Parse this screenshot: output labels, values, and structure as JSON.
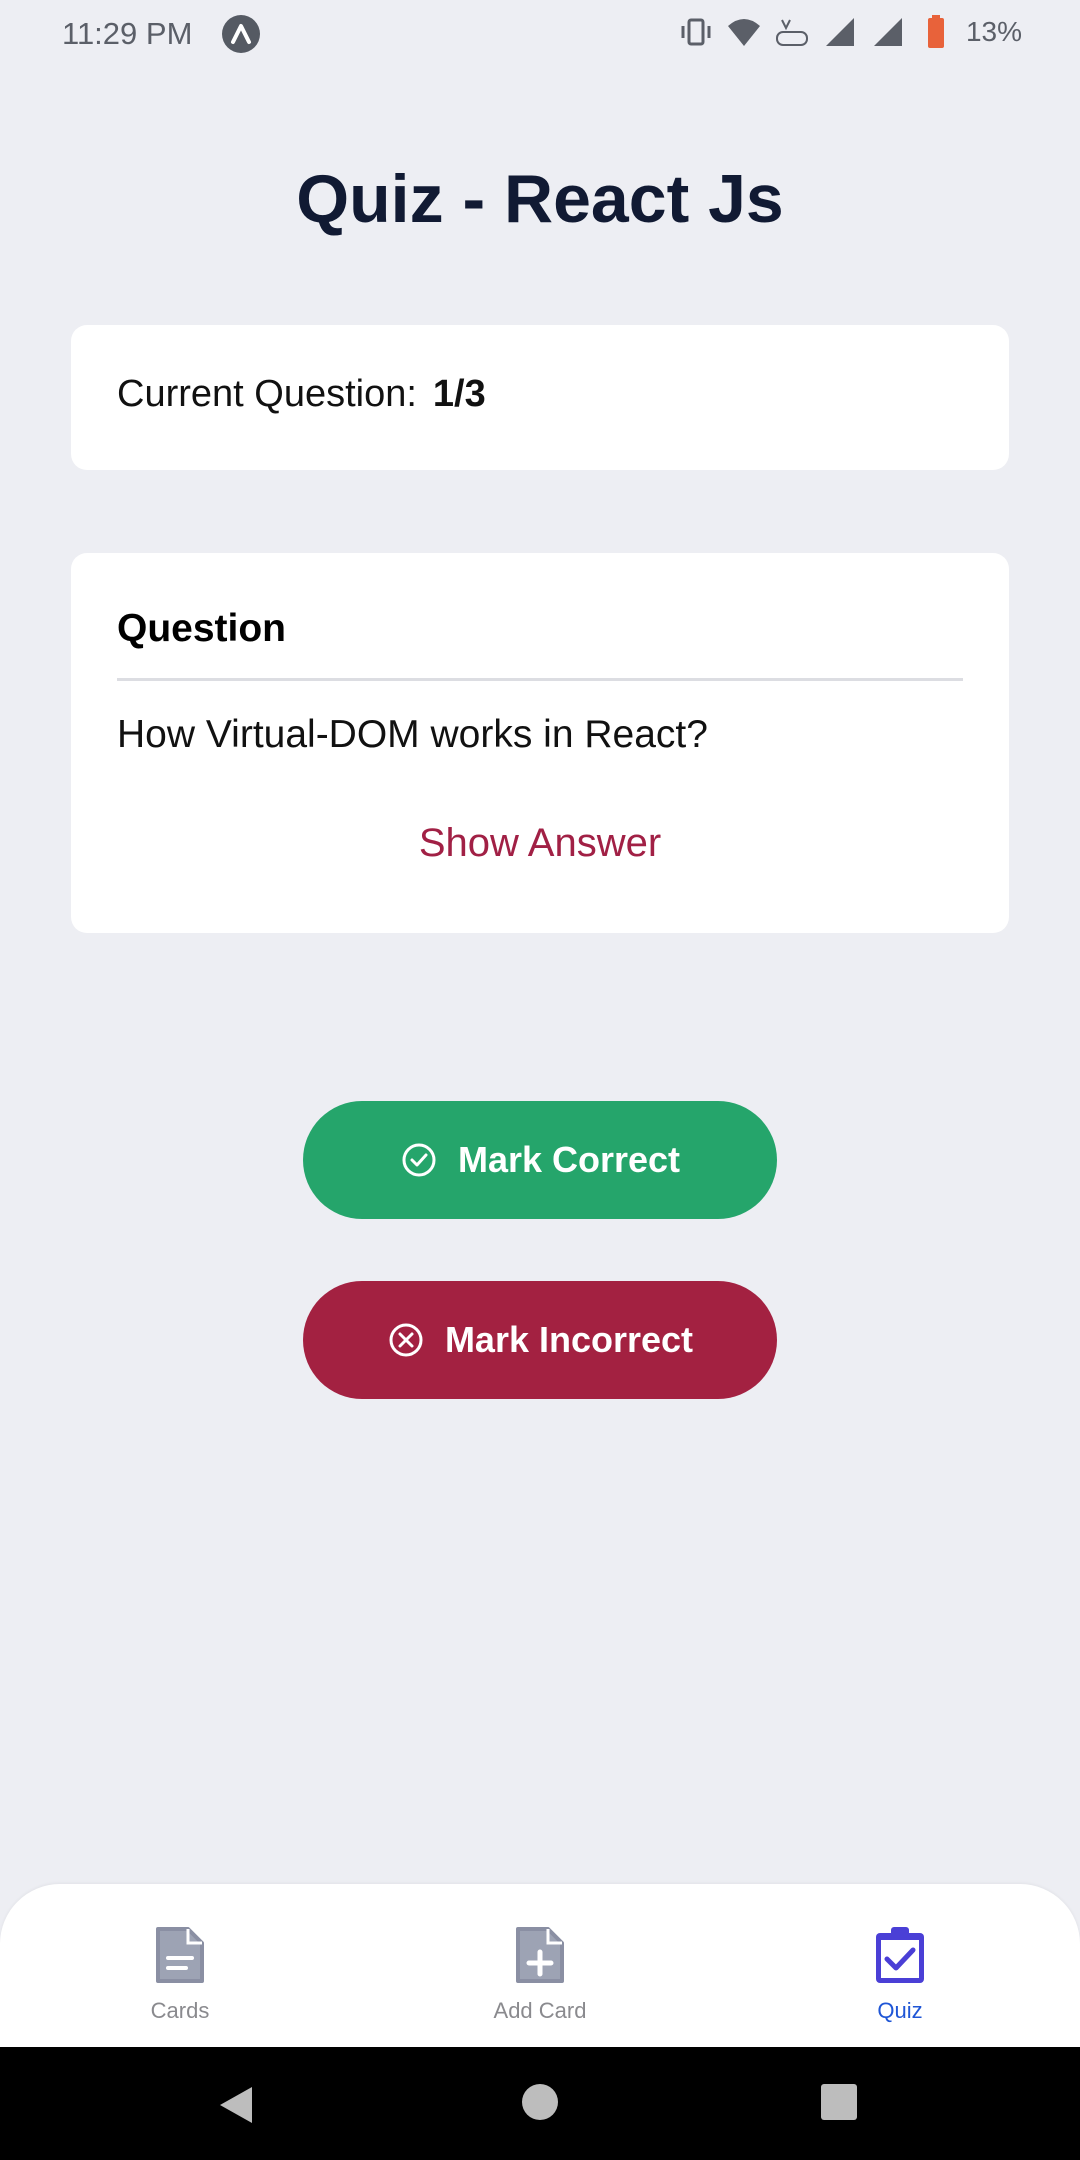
{
  "status_bar": {
    "time": "11:29 PM",
    "battery_percent": "13%",
    "icons": [
      "expo-icon",
      "vibrate-icon",
      "wifi-icon",
      "volte-icon",
      "signal-icon",
      "battery-icon"
    ]
  },
  "page": {
    "title": "Quiz - React Js"
  },
  "progress": {
    "label": "Current Question:",
    "value": "1/3",
    "current": 1,
    "total": 3
  },
  "question_card": {
    "heading": "Question",
    "text": "How Virtual-DOM works in React?",
    "show_answer_label": "Show Answer"
  },
  "actions": {
    "correct_label": "Mark Correct",
    "incorrect_label": "Mark Incorrect"
  },
  "tabs": [
    {
      "label": "Cards",
      "icon": "document-icon",
      "active": false
    },
    {
      "label": "Add Card",
      "icon": "add-document-icon",
      "active": false
    },
    {
      "label": "Quiz",
      "icon": "clipboard-check-icon",
      "active": true
    }
  ],
  "colors": {
    "background": "#EDEEF3",
    "title": "#111A33",
    "accent_red": "#A12045",
    "correct_green": "#25A56B",
    "incorrect_red": "#A32141",
    "active_tab": "#1F56D6",
    "inactive_tab": "#8A8A8E"
  }
}
